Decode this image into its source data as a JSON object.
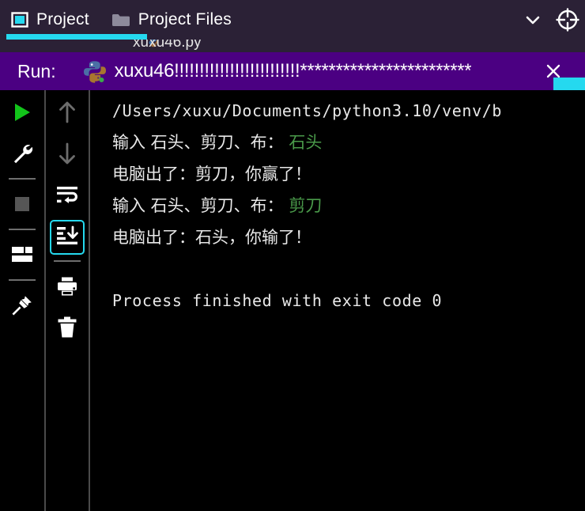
{
  "window": {
    "background": "#000000",
    "accent": "#25d9ef",
    "run_header_bg": "#4b0082"
  },
  "topbar": {
    "tabs": [
      {
        "label": "Project",
        "icon": "project-module-icon",
        "active": true
      },
      {
        "label": "Project Files",
        "icon": "folder-icon",
        "active": false
      }
    ],
    "actions": [
      {
        "name": "chevron-down-icon",
        "label": ""
      },
      {
        "name": "crosshair-target-icon",
        "label": ""
      }
    ]
  },
  "editor_behind": {
    "ghost_text": "xuxu46.py"
  },
  "run_window": {
    "label": "Run:",
    "icon": "python-file-icon",
    "title": "xuxu46!!!!!!!!!!!!!!!!!!!!!!!!!************************",
    "close_label": "×"
  },
  "gutter_primary": {
    "buttons": [
      {
        "name": "run-button",
        "icon": "play-triangle-icon",
        "state": "enabled"
      },
      {
        "name": "debug-settings-button",
        "icon": "wrench-icon",
        "state": "enabled"
      },
      {
        "name": "stop-button",
        "icon": "stop-square-icon",
        "state": "disabled"
      },
      {
        "name": "layout-button",
        "icon": "layout-grid-icon",
        "state": "enabled"
      },
      {
        "name": "pin-tab-button",
        "icon": "pin-icon",
        "state": "enabled"
      }
    ]
  },
  "gutter_secondary": {
    "buttons": [
      {
        "name": "scroll-up-button",
        "icon": "arrow-up-icon",
        "state": "disabled"
      },
      {
        "name": "scroll-down-button",
        "icon": "arrow-down-icon",
        "state": "disabled"
      },
      {
        "name": "soft-wrap-button",
        "icon": "soft-wrap-icon",
        "state": "enabled"
      },
      {
        "name": "scroll-to-end-button",
        "icon": "scroll-to-end-icon",
        "state": "selected"
      },
      {
        "name": "print-button",
        "icon": "printer-icon",
        "state": "enabled"
      },
      {
        "name": "clear-all-button",
        "icon": "trash-icon",
        "state": "enabled"
      }
    ]
  },
  "console": {
    "lines": [
      {
        "kind": "mono",
        "text": "/Users/xuxu/Documents/python3.10/venv/b"
      },
      {
        "kind": "cjk",
        "prompt": "输入 石头、剪刀、布： ",
        "input": "石头"
      },
      {
        "kind": "cjk",
        "prompt": "电脑出了：剪刀，你赢了！",
        "input": ""
      },
      {
        "kind": "cjk",
        "prompt": "输入 石头、剪刀、布： ",
        "input": "剪刀"
      },
      {
        "kind": "cjk",
        "prompt": "电脑出了：石头，你输了！",
        "input": ""
      },
      {
        "kind": "blank",
        "text": ""
      },
      {
        "kind": "mono",
        "text": "Process finished with exit code 0"
      }
    ]
  }
}
